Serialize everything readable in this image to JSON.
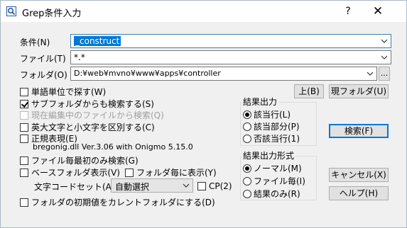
{
  "window": {
    "title": "Grep条件入力",
    "help": "?",
    "close": "✕"
  },
  "fields": {
    "condition_label": "条件(N)",
    "condition_value": "_construct",
    "file_label": "ファイル(T)",
    "file_value": "*.*",
    "folder_label": "フォルダ(O)",
    "folder_value": "D:¥web¥mvno¥www¥apps¥controller",
    "browse_label": "..."
  },
  "buttons": {
    "up": "上(B)",
    "current_folder": "現フォルダ(U)",
    "search": "検索(F)",
    "cancel": "キャンセル(X)",
    "help": "ヘルプ(H)"
  },
  "options": {
    "word_unit": "単語単位で探す(W)",
    "subfolders": "サブフォルダからも検索する(S)",
    "current_file": "現在編集中のファイルから検索(Q)",
    "case": "英大文字と小文字を区別する(C)",
    "regex": "正規表現(E)",
    "regex_lib": "bregonig.dll Ver.3.06 with Onigmo 5.15.0",
    "first_match": "ファイル毎最初のみ検索(G)",
    "base_folder": "ベースフォルダ表示(V)",
    "per_folder": "フォルダ毎に表示(Y)",
    "charset_label": "文字コードセット(A)",
    "charset_value": "自動選択",
    "cp": "CP(2)",
    "init_folder": "フォルダの初期値をカレントフォルダにする(D)"
  },
  "result_output": {
    "title": "結果出力",
    "items": [
      "該当行(L)",
      "該当部分(P)",
      "否該当行(1)"
    ]
  },
  "result_format": {
    "title": "結果出力形式",
    "items": [
      "ノーマル(M)",
      "ファイル毎(I)",
      "結果のみ(R)"
    ]
  }
}
